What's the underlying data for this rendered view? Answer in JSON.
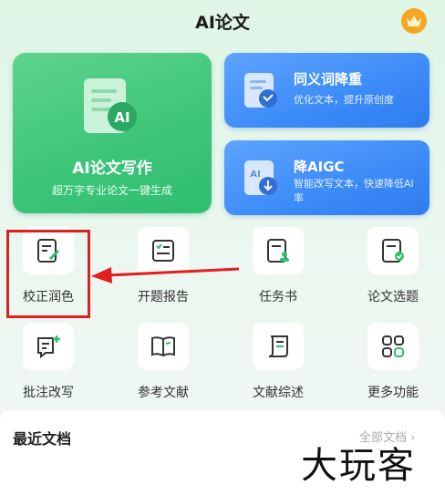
{
  "header": {
    "title": "AI论文",
    "vip_icon": "crown-icon"
  },
  "main_card": {
    "title": "AI论文写作",
    "subtitle": "超万字专业论文一键生成",
    "badge": "AI"
  },
  "side_cards": [
    {
      "title": "同义词降重",
      "subtitle": "优化文本，提升原创度"
    },
    {
      "title": "降AIGC",
      "subtitle": "智能改写文本，快速降低AI率",
      "badge": "AI"
    }
  ],
  "tools": [
    {
      "label": "校正润色",
      "icon": "edit-document-icon"
    },
    {
      "label": "开题报告",
      "icon": "checklist-document-icon"
    },
    {
      "label": "任务书",
      "icon": "assignment-document-icon"
    },
    {
      "label": "论文选题",
      "icon": "approved-document-icon"
    },
    {
      "label": "批注改写",
      "icon": "comment-add-icon"
    },
    {
      "label": "参考文献",
      "icon": "open-book-icon"
    },
    {
      "label": "文献综述",
      "icon": "scroll-document-icon"
    },
    {
      "label": "更多功能",
      "icon": "grid-more-icon"
    }
  ],
  "recent": {
    "title": "最近文档",
    "all_link": "全部文档 ›"
  },
  "watermark": "大玩客",
  "colors": {
    "green": "#3ec67b",
    "blue": "#3c8bf7",
    "highlight": "#e02020",
    "gold": "#f5a623"
  }
}
